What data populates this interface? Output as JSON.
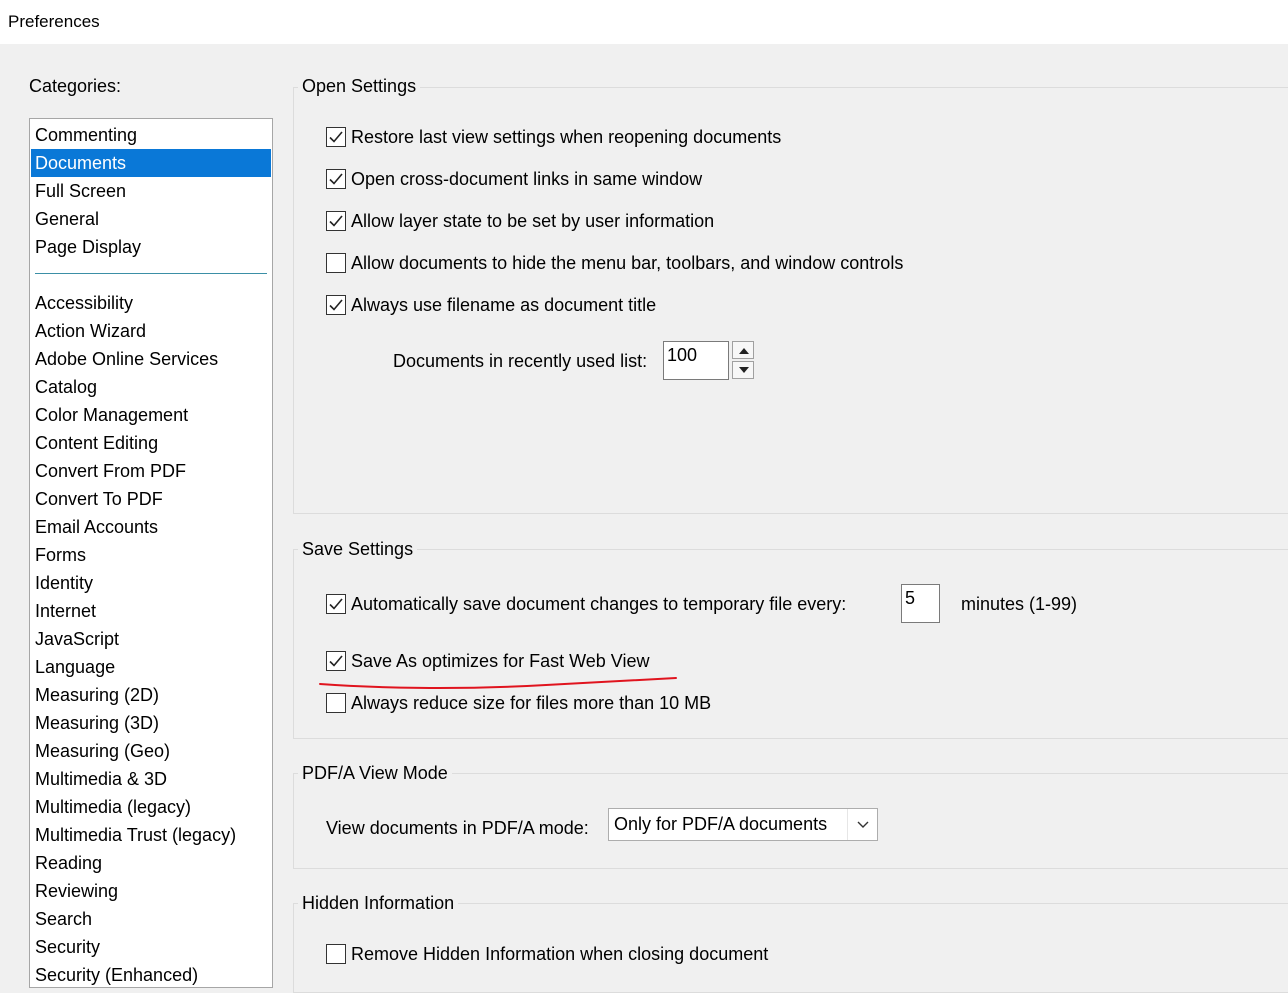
{
  "window": {
    "title": "Preferences"
  },
  "categories": {
    "label": "Categories:",
    "top_items": [
      "Commenting",
      "Documents",
      "Full Screen",
      "General",
      "Page Display"
    ],
    "selected": "Documents",
    "items": [
      "Accessibility",
      "Action Wizard",
      "Adobe Online Services",
      "Catalog",
      "Color Management",
      "Content Editing",
      "Convert From PDF",
      "Convert To PDF",
      "Email Accounts",
      "Forms",
      "Identity",
      "Internet",
      "JavaScript",
      "Language",
      "Measuring (2D)",
      "Measuring (3D)",
      "Measuring (Geo)",
      "Multimedia & 3D",
      "Multimedia (legacy)",
      "Multimedia Trust (legacy)",
      "Reading",
      "Reviewing",
      "Search",
      "Security",
      "Security (Enhanced)"
    ]
  },
  "open_settings": {
    "title": "Open Settings",
    "restore_view": {
      "label": "Restore last view settings when reopening documents",
      "checked": true
    },
    "cross_doc_links": {
      "label": "Open cross-document links in same window",
      "checked": true
    },
    "layer_state": {
      "label": "Allow layer state to be set by user information",
      "checked": true
    },
    "hide_menu": {
      "label": "Allow documents to hide the menu bar, toolbars, and window controls",
      "checked": false
    },
    "filename_title": {
      "label": "Always use filename as document title",
      "checked": true
    },
    "recent_list_label": "Documents in recently used list:",
    "recent_list_value": "100"
  },
  "save_settings": {
    "title": "Save Settings",
    "autosave": {
      "label": "Automatically save document changes to temporary file every:",
      "checked": true
    },
    "autosave_value": "5",
    "autosave_unit": "minutes (1-99)",
    "fast_web_view": {
      "label": "Save As optimizes for Fast Web View",
      "checked": true
    },
    "reduce_size": {
      "label": "Always reduce size for files more than 10 MB",
      "checked": false
    }
  },
  "pdfa": {
    "title": "PDF/A View Mode",
    "label": "View documents in PDF/A mode:",
    "selected": "Only for PDF/A documents"
  },
  "hidden_info": {
    "title": "Hidden Information",
    "remove_hidden": {
      "label": "Remove Hidden Information when closing document",
      "checked": false
    }
  },
  "colors": {
    "selection": "#0a78d7",
    "annotation": "#e0141e"
  }
}
